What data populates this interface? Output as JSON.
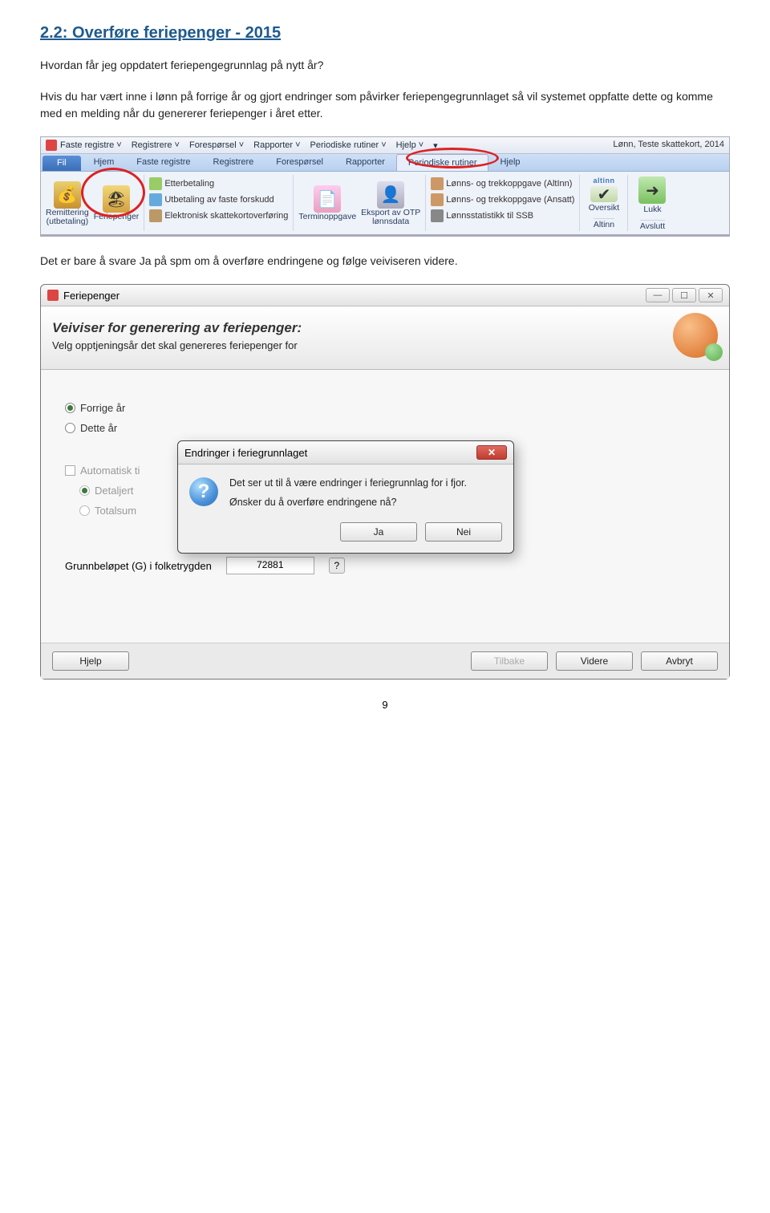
{
  "heading": "2.2: Overføre feriepenger - 2015",
  "intro1": "Hvordan får jeg oppdatert feriepengegrunnlag på nytt år?",
  "intro2": "Hvis du har vært inne i lønn på forrige år og gjort endringer som påvirker feriepengegrunnlaget så vil systemet oppfatte dette og komme med en melding når du genererer feriepenger i året etter.",
  "intro3": "Det er bare å svare Ja på spm om å overføre endringene og følge veiviseren videre.",
  "page_number": "9",
  "ribbon": {
    "menus": [
      "Faste registre ˅",
      "Registrere ˅",
      "Forespørsel ˅",
      "Rapporter ˅",
      "Periodiske rutiner ˅",
      "Hjelp ˅",
      "▾"
    ],
    "context": "Lønn, Teste skattekort, 2014",
    "tab_fil": "Fil",
    "tabs": [
      "Hjem",
      "Faste registre",
      "Registrere",
      "Forespørsel",
      "Rapporter",
      "Periodiske rutiner",
      "Hjelp"
    ],
    "grp1a": "Remittering\n(utbetaling)",
    "grp1b": "Feriepenger",
    "grp2": [
      "Etterbetaling",
      "Utbetaling av faste forskudd",
      "Elektronisk skattekortoverføring"
    ],
    "grp3a": "Terminoppgave",
    "grp3b": "Eksport av OTP\nlønnsdata",
    "grp4": [
      "Lønns- og trekkoppgave (AltInn)",
      "Lønns- og trekkoppgave (Ansatt)",
      "Lønnsstatistikk til SSB"
    ],
    "grp5a": "Oversikt",
    "grp5_section": "Altinn",
    "grp6a": "Lukk",
    "grp6_section": "Avslutt",
    "altinn_label": "altinn"
  },
  "wizard": {
    "window_title": "Feriepenger",
    "header": "Veiviser for generering av feriepenger:",
    "subheader": "Velg opptjeningsår det skal genereres feriepenger for",
    "opt_forrige": "Forrige år",
    "opt_dette": "Dette år",
    "chk_auto": "Automatisk ti",
    "opt_detaljert": "Detaljert",
    "opt_totalsum": "Totalsum",
    "grunn_label": "Grunnbeløpet (G) i folketrygden",
    "grunn_value": "72881",
    "help": "?",
    "btn_hjelp": "Hjelp",
    "btn_tilbake": "Tilbake",
    "btn_videre": "Videre",
    "btn_avbryt": "Avbryt"
  },
  "dialog": {
    "title": "Endringer i feriegrunnlaget",
    "line1": "Det ser ut til å være endringer i feriegrunnlag for i fjor.",
    "line2": "Ønsker du å overføre endringene nå?",
    "btn_ja": "Ja",
    "btn_nei": "Nei"
  }
}
